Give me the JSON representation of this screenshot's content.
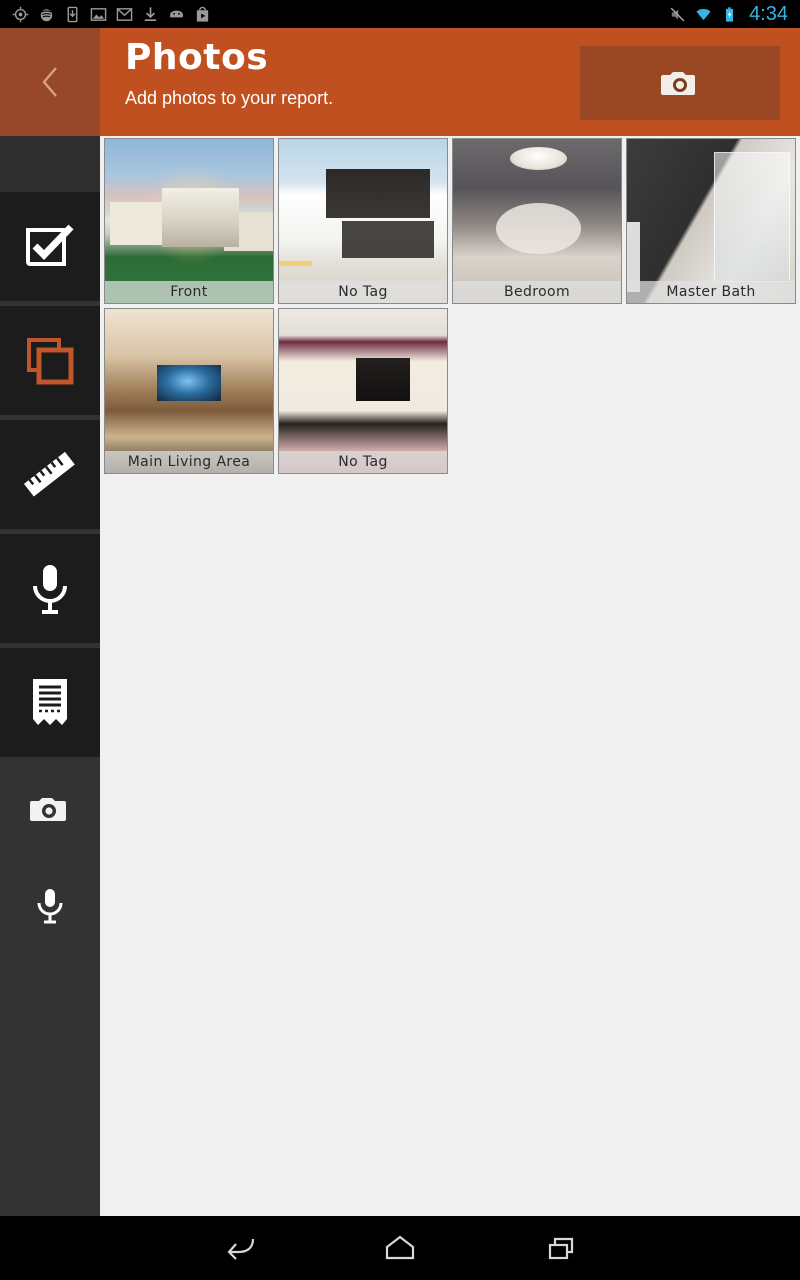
{
  "status_bar": {
    "icons_left": [
      "gps-icon",
      "spotify-icon",
      "device-download-icon",
      "gallery-icon",
      "gmail-icon",
      "download-icon",
      "android-head-icon",
      "play-store-icon"
    ],
    "icons_right": [
      "mute-icon",
      "wifi-icon",
      "battery-charging-icon"
    ],
    "clock": "4:34",
    "clock_color": "#33b5e5"
  },
  "header": {
    "title": "Photos",
    "subtitle": "Add photos to your report.",
    "back_icon": "chevron-left-icon",
    "camera_icon": "camera-icon",
    "accent_color": "#c0501f",
    "accent_dark_color": "#97472a",
    "button_color": "#9a4824"
  },
  "sidebar": {
    "items": [
      {
        "name": "checklist",
        "icon": "checkbox-checked-icon",
        "active": false
      },
      {
        "name": "photos",
        "icon": "photos-stack-icon",
        "active": true
      },
      {
        "name": "measure",
        "icon": "ruler-icon",
        "active": false
      },
      {
        "name": "voice-note",
        "icon": "microphone-icon",
        "active": false
      },
      {
        "name": "report",
        "icon": "report-receipt-icon",
        "active": false
      }
    ],
    "sub_items": [
      {
        "name": "add-photo",
        "icon": "camera-icon"
      },
      {
        "name": "add-voice-note",
        "icon": "microphone-small-icon"
      }
    ],
    "active_color": "#c0562b"
  },
  "photos": [
    {
      "label": "Front",
      "art": "art-front"
    },
    {
      "label": "No Tag",
      "art": "art-modern"
    },
    {
      "label": "Bedroom",
      "art": "art-bedroom"
    },
    {
      "label": "Master Bath",
      "art": "art-bath"
    },
    {
      "label": "Main Living Area",
      "art": "art-living"
    },
    {
      "label": "No Tag",
      "art": "art-notag2"
    }
  ],
  "nav_bar": {
    "back": "back-icon",
    "home": "home-icon",
    "recents": "recents-icon"
  }
}
